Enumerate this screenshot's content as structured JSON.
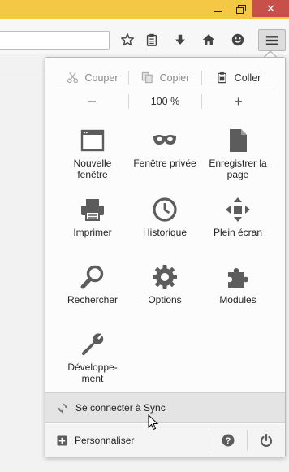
{
  "window": {
    "close_glyph": "✕",
    "titlebar_color": "#f4c744",
    "close_color": "#c7504b"
  },
  "toolbar": {
    "icons": [
      "star-icon",
      "reading-list-icon",
      "download-icon",
      "home-icon",
      "smiley-icon",
      "hamburger-menu-icon"
    ]
  },
  "menu": {
    "edit": {
      "cut": "Couper",
      "copy": "Copier",
      "paste": "Coller"
    },
    "zoom": {
      "minus": "−",
      "level": "100 %",
      "plus": "+"
    },
    "items": [
      {
        "label": "Nouvelle fenêtre",
        "icon": "new-window-icon"
      },
      {
        "label": "Fenêtre privée",
        "icon": "private-mask-icon"
      },
      {
        "label": "Enregistrer la page",
        "icon": "save-page-icon"
      },
      {
        "label": "Imprimer",
        "icon": "printer-icon"
      },
      {
        "label": "Historique",
        "icon": "history-clock-icon"
      },
      {
        "label": "Plein écran",
        "icon": "fullscreen-arrows-icon"
      },
      {
        "label": "Rechercher",
        "icon": "magnifier-icon"
      },
      {
        "label": "Options",
        "icon": "gear-icon"
      },
      {
        "label": "Modules",
        "icon": "puzzle-icon"
      },
      {
        "label": "Développe-ment",
        "icon": "wrench-icon"
      }
    ],
    "sync_label": "Se connecter à Sync",
    "customize_label": "Personnaliser",
    "help_glyph": "?"
  }
}
